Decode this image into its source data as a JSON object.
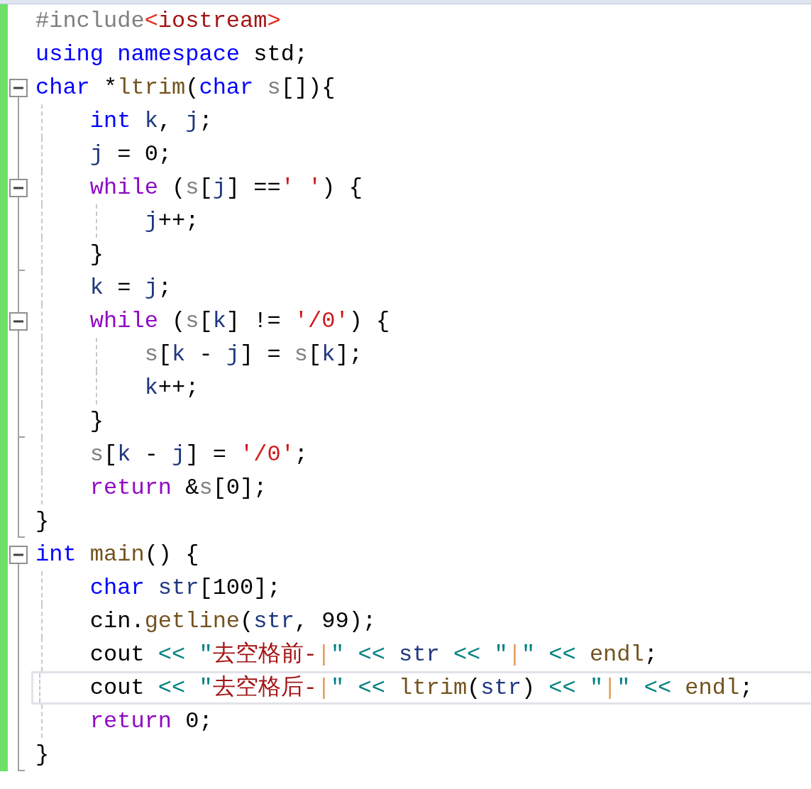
{
  "editor": {
    "lines": [
      {
        "kind": "none",
        "current": false,
        "tokens": [
          {
            "kind": "preproc",
            "text": "#include"
          },
          {
            "kind": "angle",
            "text": "<"
          },
          {
            "kind": "string",
            "text": "iostream"
          },
          {
            "kind": "angle",
            "text": ">"
          }
        ]
      },
      {
        "kind": "none",
        "current": false,
        "tokens": [
          {
            "kind": "keyword",
            "text": "using"
          },
          {
            "kind": "keyword",
            "text": " namespace"
          },
          {
            "kind": "plain",
            "text": " std;"
          }
        ]
      },
      {
        "kind": "start",
        "expanded": true,
        "current": false,
        "tokens": [
          {
            "kind": "keyword",
            "text": "char"
          },
          {
            "kind": "plain",
            "text": " *"
          },
          {
            "kind": "func",
            "text": "ltrim"
          },
          {
            "kind": "plain",
            "text": "("
          },
          {
            "kind": "keyword",
            "text": "char"
          },
          {
            "kind": "param",
            "text": " s"
          },
          {
            "kind": "plain",
            "text": "[]){"
          }
        ]
      },
      {
        "kind": "line",
        "current": false,
        "tokens": [
          {
            "kind": "keyword",
            "text": "    int"
          },
          {
            "kind": "local",
            "text": " k"
          },
          {
            "kind": "plain",
            "text": ", "
          },
          {
            "kind": "local",
            "text": "j"
          },
          {
            "kind": "plain",
            "text": ";"
          }
        ]
      },
      {
        "kind": "line",
        "current": false,
        "tokens": [
          {
            "kind": "local",
            "text": "    j"
          },
          {
            "kind": "plain",
            "text": " = 0;"
          }
        ]
      },
      {
        "kind": "start",
        "expanded": true,
        "current": false,
        "tokens": [
          {
            "kind": "control",
            "text": "    while"
          },
          {
            "kind": "plain",
            "text": " ("
          },
          {
            "kind": "param",
            "text": "s"
          },
          {
            "kind": "plain",
            "text": "["
          },
          {
            "kind": "local",
            "text": "j"
          },
          {
            "kind": "plain",
            "text": "] =="
          },
          {
            "kind": "char",
            "text": "' '"
          },
          {
            "kind": "plain",
            "text": ") {"
          }
        ]
      },
      {
        "kind": "line",
        "current": false,
        "tokens": [
          {
            "kind": "local",
            "text": "        j"
          },
          {
            "kind": "plain",
            "text": "++;"
          }
        ]
      },
      {
        "kind": "tick",
        "current": false,
        "tokens": [
          {
            "kind": "plain",
            "text": "    }"
          }
        ]
      },
      {
        "kind": "line",
        "current": false,
        "tokens": [
          {
            "kind": "local",
            "text": "    k"
          },
          {
            "kind": "plain",
            "text": " = "
          },
          {
            "kind": "local",
            "text": "j"
          },
          {
            "kind": "plain",
            "text": ";"
          }
        ]
      },
      {
        "kind": "start",
        "expanded": true,
        "current": false,
        "tokens": [
          {
            "kind": "control",
            "text": "    while"
          },
          {
            "kind": "plain",
            "text": " ("
          },
          {
            "kind": "param",
            "text": "s"
          },
          {
            "kind": "plain",
            "text": "["
          },
          {
            "kind": "local",
            "text": "k"
          },
          {
            "kind": "plain",
            "text": "] != "
          },
          {
            "kind": "char",
            "text": "'/0'"
          },
          {
            "kind": "plain",
            "text": ") {"
          }
        ]
      },
      {
        "kind": "line",
        "current": false,
        "tokens": [
          {
            "kind": "param",
            "text": "        s"
          },
          {
            "kind": "plain",
            "text": "["
          },
          {
            "kind": "local",
            "text": "k"
          },
          {
            "kind": "plain",
            "text": " - "
          },
          {
            "kind": "local",
            "text": "j"
          },
          {
            "kind": "plain",
            "text": "] = "
          },
          {
            "kind": "param",
            "text": "s"
          },
          {
            "kind": "plain",
            "text": "["
          },
          {
            "kind": "local",
            "text": "k"
          },
          {
            "kind": "plain",
            "text": "];"
          }
        ]
      },
      {
        "kind": "line",
        "current": false,
        "tokens": [
          {
            "kind": "local",
            "text": "        k"
          },
          {
            "kind": "plain",
            "text": "++;"
          }
        ]
      },
      {
        "kind": "tick",
        "current": false,
        "tokens": [
          {
            "kind": "plain",
            "text": "    }"
          }
        ]
      },
      {
        "kind": "line",
        "current": false,
        "tokens": [
          {
            "kind": "param",
            "text": "    s"
          },
          {
            "kind": "plain",
            "text": "["
          },
          {
            "kind": "local",
            "text": "k"
          },
          {
            "kind": "plain",
            "text": " - "
          },
          {
            "kind": "local",
            "text": "j"
          },
          {
            "kind": "plain",
            "text": "] = "
          },
          {
            "kind": "char",
            "text": "'/0'"
          },
          {
            "kind": "plain",
            "text": ";"
          }
        ]
      },
      {
        "kind": "line",
        "current": false,
        "tokens": [
          {
            "kind": "control",
            "text": "    return"
          },
          {
            "kind": "plain",
            "text": " &"
          },
          {
            "kind": "param",
            "text": "s"
          },
          {
            "kind": "plain",
            "text": "[0];"
          }
        ]
      },
      {
        "kind": "end",
        "current": false,
        "tokens": [
          {
            "kind": "plain",
            "text": "}"
          }
        ]
      },
      {
        "kind": "start",
        "expanded": true,
        "current": false,
        "tokens": [
          {
            "kind": "keyword",
            "text": "int"
          },
          {
            "kind": "func",
            "text": " main"
          },
          {
            "kind": "plain",
            "text": "() {"
          }
        ]
      },
      {
        "kind": "line",
        "current": false,
        "tokens": [
          {
            "kind": "keyword",
            "text": "    char"
          },
          {
            "kind": "local",
            "text": " str"
          },
          {
            "kind": "plain",
            "text": "[100];"
          }
        ]
      },
      {
        "kind": "line",
        "current": false,
        "tokens": [
          {
            "kind": "plain",
            "text": "    cin."
          },
          {
            "kind": "func",
            "text": "getline"
          },
          {
            "kind": "plain",
            "text": "("
          },
          {
            "kind": "local",
            "text": "str"
          },
          {
            "kind": "plain",
            "text": ", 99);"
          }
        ]
      },
      {
        "kind": "line",
        "current": false,
        "tokens": [
          {
            "kind": "plain",
            "text": "    cout "
          },
          {
            "kind": "op",
            "text": "<< \""
          },
          {
            "kind": "string",
            "text": "去空格前-"
          },
          {
            "kind": "bar",
            "text": "|"
          },
          {
            "kind": "op",
            "text": "\" << "
          },
          {
            "kind": "local",
            "text": "str"
          },
          {
            "kind": "op",
            "text": " << \""
          },
          {
            "kind": "bar",
            "text": "|"
          },
          {
            "kind": "op",
            "text": "\" << "
          },
          {
            "kind": "func",
            "text": "endl"
          },
          {
            "kind": "plain",
            "text": ";"
          }
        ]
      },
      {
        "kind": "line",
        "current": true,
        "tokens": [
          {
            "kind": "plain",
            "text": "    cout "
          },
          {
            "kind": "op",
            "text": "<< \""
          },
          {
            "kind": "string",
            "text": "去空格后-"
          },
          {
            "kind": "bar",
            "text": "|"
          },
          {
            "kind": "op",
            "text": "\" << "
          },
          {
            "kind": "func",
            "text": "ltrim"
          },
          {
            "kind": "plain",
            "text": "("
          },
          {
            "kind": "local",
            "text": "str"
          },
          {
            "kind": "plain",
            "text": ")"
          },
          {
            "kind": "op",
            "text": " << \""
          },
          {
            "kind": "bar",
            "text": "|"
          },
          {
            "kind": "op",
            "text": "\" << "
          },
          {
            "kind": "func",
            "text": "endl"
          },
          {
            "kind": "plain",
            "text": ";"
          }
        ]
      },
      {
        "kind": "line",
        "current": false,
        "tokens": [
          {
            "kind": "control",
            "text": "    return"
          },
          {
            "kind": "plain",
            "text": " 0;"
          }
        ]
      },
      {
        "kind": "end",
        "current": false,
        "tokens": [
          {
            "kind": "plain",
            "text": "}"
          }
        ]
      }
    ]
  }
}
